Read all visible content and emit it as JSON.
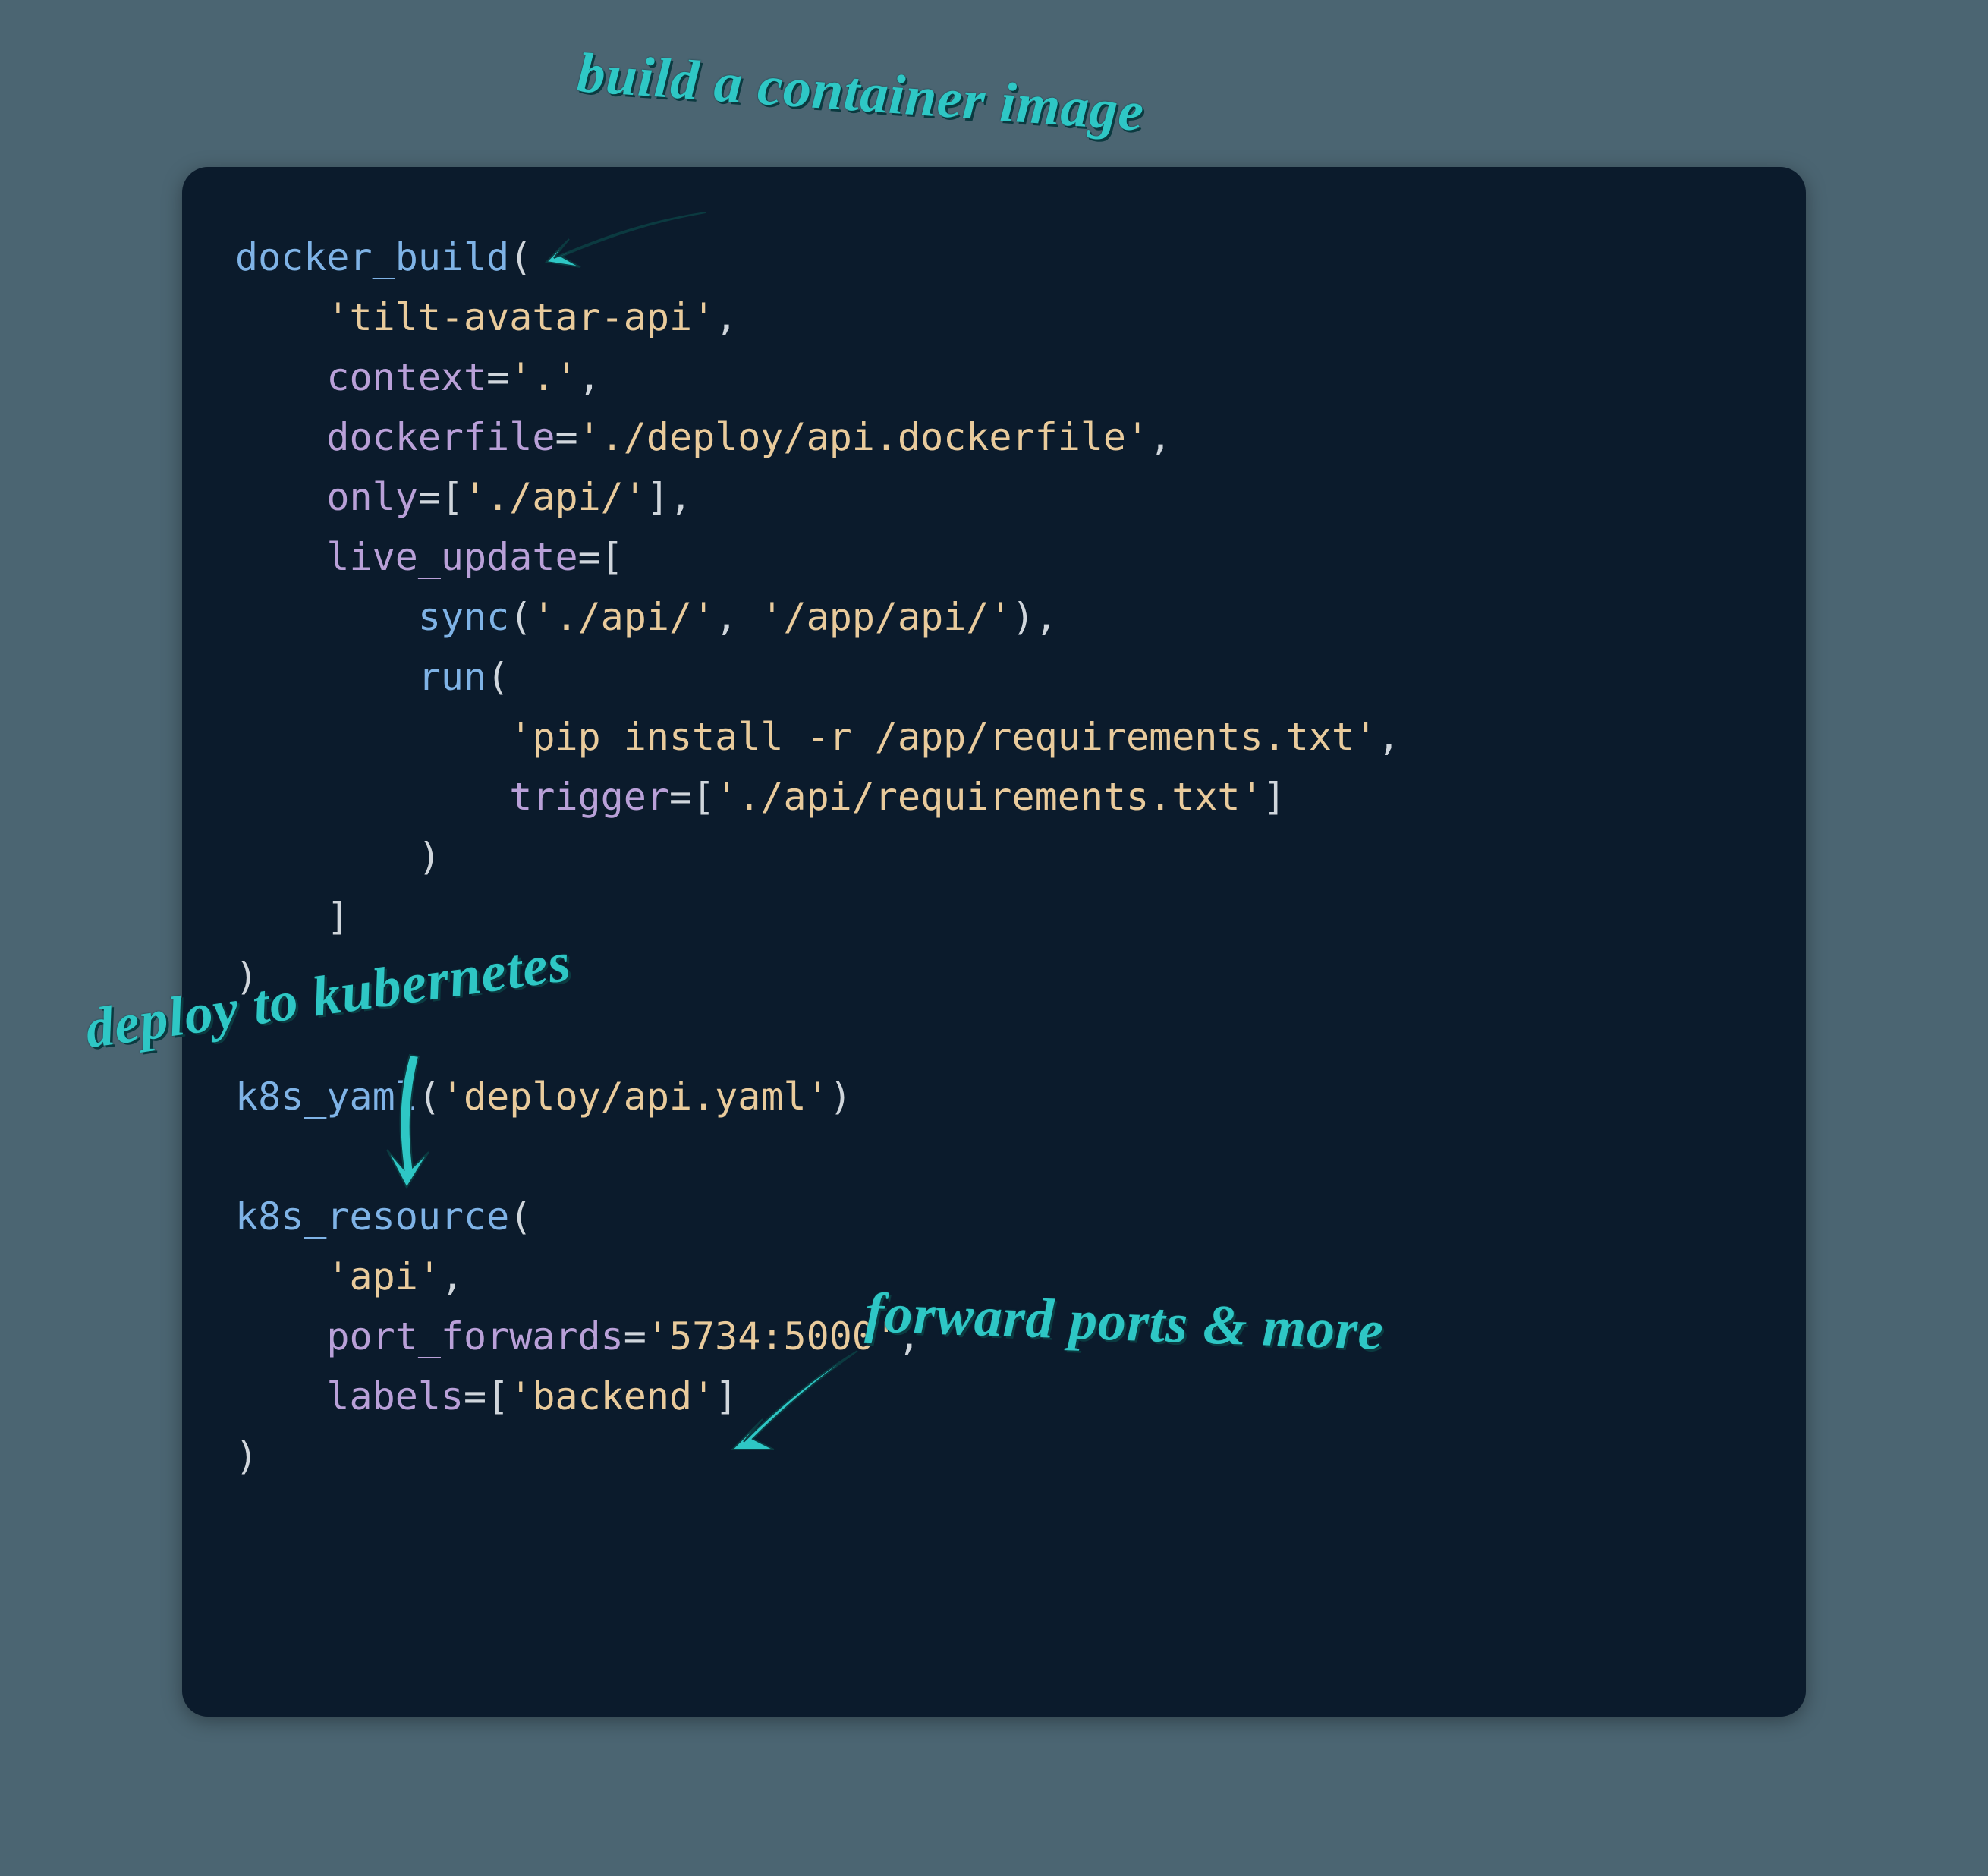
{
  "annotations": {
    "build": "build a container image",
    "deploy": "deploy to kubernetes",
    "forward": "forward ports & more"
  },
  "code": {
    "fn_docker_build": "docker_build",
    "open_paren": "(",
    "close_paren": ")",
    "comma": ",",
    "eq": "=",
    "open_bracket": "[",
    "close_bracket": "]",
    "str_tilt_avatar_api": "'tilt-avatar-api'",
    "kw_context": "context",
    "str_dot": "'.'",
    "kw_dockerfile": "dockerfile",
    "str_dockerfile_path": "'./deploy/api.dockerfile'",
    "kw_only": "only",
    "str_api_dir": "'./api/'",
    "kw_live_update": "live_update",
    "fn_sync": "sync",
    "str_app_api": "'/app/api/'",
    "fn_run": "run",
    "str_pip_install": "'pip install -r /app/requirements.txt'",
    "kw_trigger": "trigger",
    "str_req_path": "'./api/requirements.txt'",
    "fn_k8s_yaml": "k8s_yaml",
    "str_deploy_yaml": "'deploy/api.yaml'",
    "fn_k8s_resource": "k8s_resource",
    "str_api": "'api'",
    "kw_port_forwards": "port_forwards",
    "str_ports": "'5734:5000'",
    "kw_labels": "labels",
    "str_backend": "'backend'"
  }
}
